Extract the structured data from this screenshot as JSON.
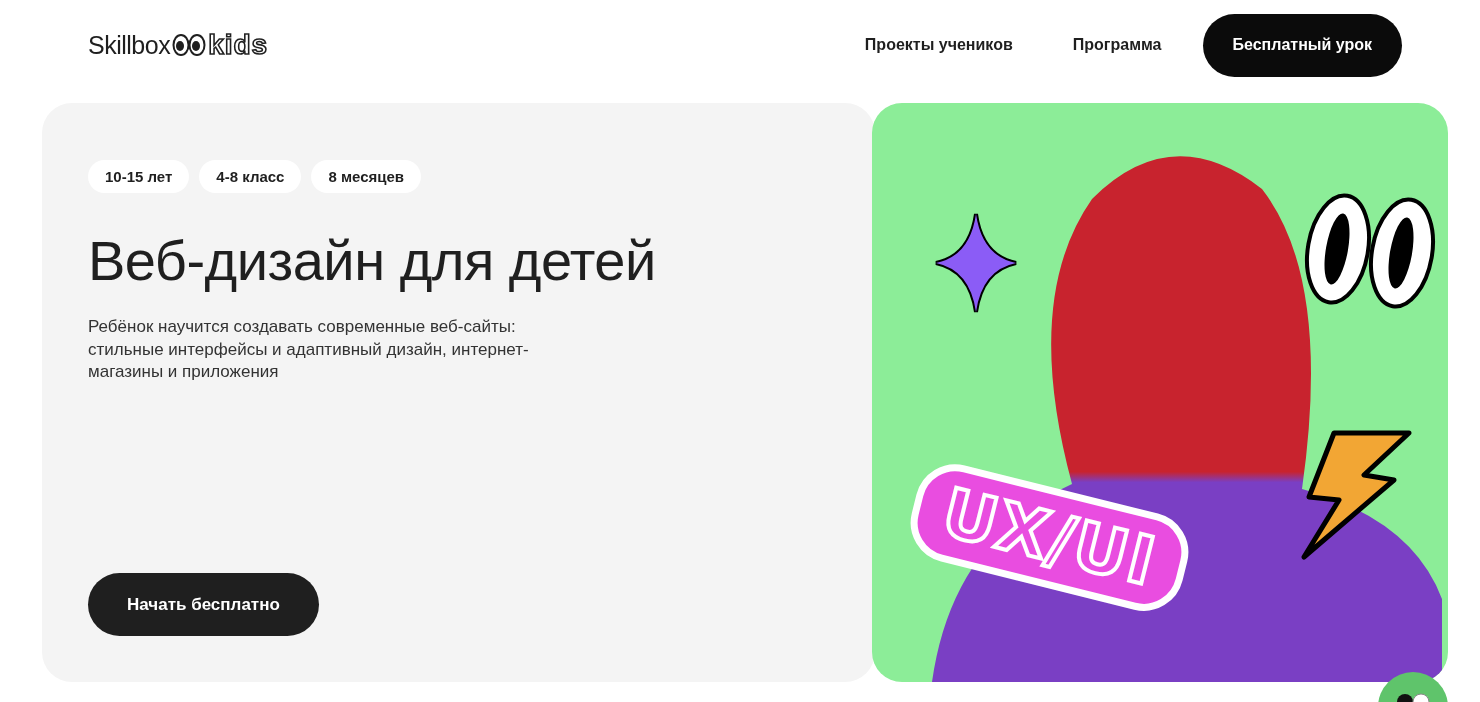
{
  "header": {
    "logo": {
      "word": "Skillbox",
      "suffix": "kids"
    },
    "nav": [
      {
        "label": "Проекты учеников",
        "kind": "link"
      },
      {
        "label": "Программа",
        "kind": "link"
      },
      {
        "label": "Бесплатный урок",
        "kind": "button"
      }
    ]
  },
  "hero": {
    "tags": [
      "10-15 лет",
      "4-8 класс",
      "8 месяцев"
    ],
    "title": "Веб-дизайн для детей",
    "description": "Ребёнок научится создавать современные веб-сайты: стильные интерфейсы и адаптивный дизайн, интернет-магазины и приложения",
    "cta": "Начать бесплатно",
    "sticker_text": "UX/UI"
  }
}
